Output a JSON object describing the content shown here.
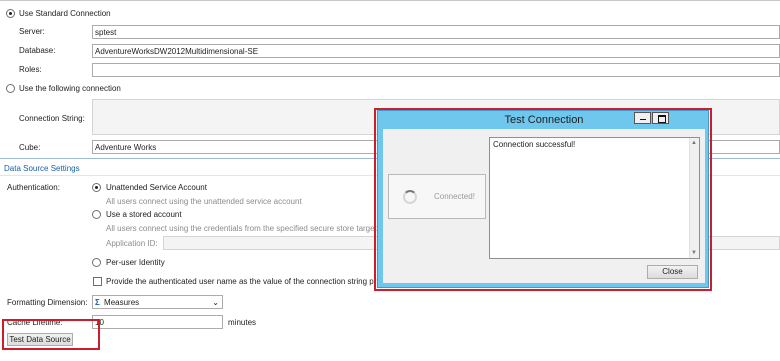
{
  "connection": {
    "use_standard_label": "Use Standard Connection",
    "server_label": "Server:",
    "server_value": "sptest",
    "database_label": "Database:",
    "database_value": "AdventureWorksDW2012Multidimensional-SE",
    "roles_label": "Roles:",
    "roles_value": "",
    "use_following_label": "Use the following connection",
    "connection_string_label": "Connection String:",
    "connection_string_value": "",
    "cube_label": "Cube:",
    "cube_value": "Adventure Works"
  },
  "settings": {
    "section_title": "Data Source Settings",
    "authentication_label": "Authentication:",
    "unattended_label": "Unattended Service Account",
    "unattended_desc": "All users connect using the unattended service account",
    "stored_label": "Use a stored account",
    "stored_desc": "All users connect using the credentials from the specified secure store target",
    "app_id_label": "Application ID:",
    "app_id_value": "",
    "per_user_label": "Per-user Identity",
    "provide_user_label": "Provide the authenticated user name as the value of the connection string pr",
    "formatting_label": "Formatting Dimension:",
    "formatting_icon_text": "Σ",
    "formatting_value": "Measures",
    "cache_label": "Cache Lifetime:",
    "cache_value": "10",
    "cache_unit": "minutes",
    "test_button": "Test Data Source"
  },
  "dialog": {
    "title": "Test Connection",
    "status_text": "Connected!",
    "message": "Connection successful!",
    "close_button": "Close"
  },
  "colors": {
    "dialog_title_bar": "#6fc7ee",
    "highlight_red": "#cc1e2a",
    "section_blue": "#1a5fa8"
  }
}
